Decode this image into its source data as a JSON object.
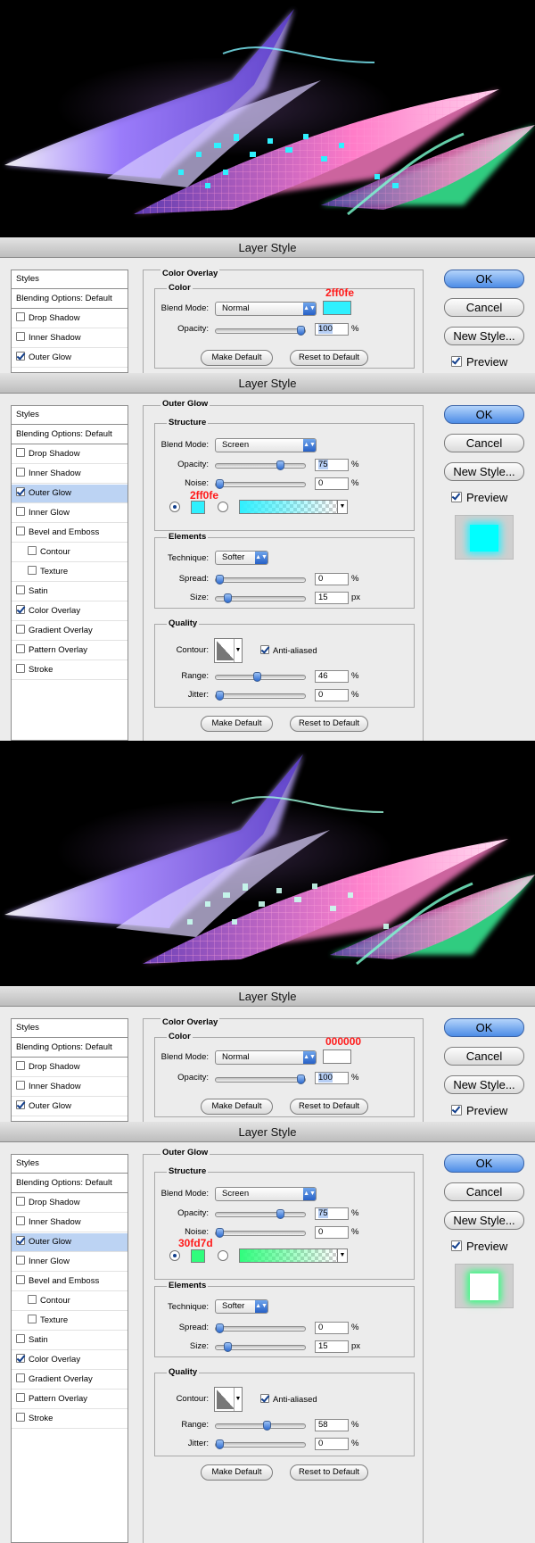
{
  "dialog_title": "Layer Style",
  "buttons": {
    "ok": "OK",
    "cancel": "Cancel",
    "new_style": "New Style...",
    "preview": "Preview"
  },
  "styles_list": {
    "header": "Styles",
    "blending": "Blending Options: Default",
    "short_items": [
      "Drop Shadow",
      "Inner Shadow",
      "Outer Glow"
    ],
    "full_items": [
      "Drop Shadow",
      "Inner Shadow",
      "Outer Glow",
      "Inner Glow",
      "Bevel and Emboss",
      "Contour",
      "Texture",
      "Satin",
      "Color Overlay",
      "Gradient Overlay",
      "Pattern Overlay",
      "Stroke"
    ]
  },
  "color_overlay": {
    "section": "Color Overlay",
    "group": "Color",
    "blend_mode_label": "Blend Mode:",
    "opacity_label": "Opacity:",
    "unit_pct": "%",
    "make_default": "Make Default",
    "reset_default": "Reset to Default"
  },
  "outer_glow": {
    "section": "Outer Glow",
    "structure": "Structure",
    "blend_mode_label": "Blend Mode:",
    "blend_mode": "Screen",
    "opacity_label": "Opacity:",
    "noise_label": "Noise:",
    "elements": "Elements",
    "technique_label": "Technique:",
    "technique": "Softer",
    "spread_label": "Spread:",
    "size_label": "Size:",
    "quality": "Quality",
    "contour_label": "Contour:",
    "anti_aliased": "Anti-aliased",
    "range_label": "Range:",
    "jitter_label": "Jitter:",
    "unit_pct": "%",
    "unit_px": "px",
    "make_default": "Make Default",
    "reset_default": "Reset to Default"
  },
  "panels": [
    {
      "type": "color_overlay",
      "blend_mode": "Normal",
      "opacity": "100",
      "opacity_fraction": 1.0,
      "swatch_color": "#2ff0fe",
      "color_note": "2ff0fe"
    },
    {
      "type": "outer_glow",
      "opacity": "75",
      "opacity_fraction": 0.75,
      "noise": "0",
      "noise_fraction": 0.0,
      "glow_color": "#2ff0fe",
      "color_note": "2ff0fe",
      "spread": "0",
      "spread_fraction": 0.0,
      "size": "15",
      "size_fraction": 0.1,
      "range": "46",
      "range_fraction": 0.46,
      "jitter": "0",
      "jitter_fraction": 0.0,
      "preview_color": "#00ffff"
    },
    {
      "type": "color_overlay",
      "blend_mode": "Normal",
      "opacity": "100",
      "opacity_fraction": 1.0,
      "swatch_color": "#ffffff",
      "color_note": "000000"
    },
    {
      "type": "outer_glow",
      "opacity": "75",
      "opacity_fraction": 0.75,
      "noise": "0",
      "noise_fraction": 0.0,
      "glow_color": "#30fd7d",
      "color_note": "30fd7d",
      "spread": "0",
      "spread_fraction": 0.0,
      "size": "15",
      "size_fraction": 0.1,
      "range": "58",
      "range_fraction": 0.58,
      "jitter": "0",
      "jitter_fraction": 0.0,
      "preview_color": "#ffffff"
    }
  ],
  "colors": {
    "cyan": "#2ff0fe",
    "green": "#30fd7d",
    "selection": "#bcd3f3",
    "annotation": "#ff1a1a"
  }
}
